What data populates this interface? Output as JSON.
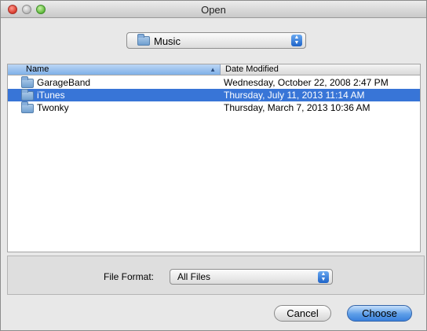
{
  "window": {
    "title": "Open"
  },
  "location": {
    "label": "Music"
  },
  "columns": {
    "name": "Name",
    "date": "Date Modified"
  },
  "files": [
    {
      "name": "GarageBand",
      "date": "Wednesday, October 22, 2008 2:47 PM",
      "selected": false
    },
    {
      "name": "iTunes",
      "date": "Thursday, July 11, 2013 11:14 AM",
      "selected": true
    },
    {
      "name": "Twonky",
      "date": "Thursday, March 7, 2013 10:36 AM",
      "selected": false
    }
  ],
  "format": {
    "label": "File Format:",
    "value": "All Files"
  },
  "buttons": {
    "cancel": "Cancel",
    "choose": "Choose"
  },
  "colors": {
    "selection": "#3875d7",
    "default_button": "#5d9ee8"
  }
}
